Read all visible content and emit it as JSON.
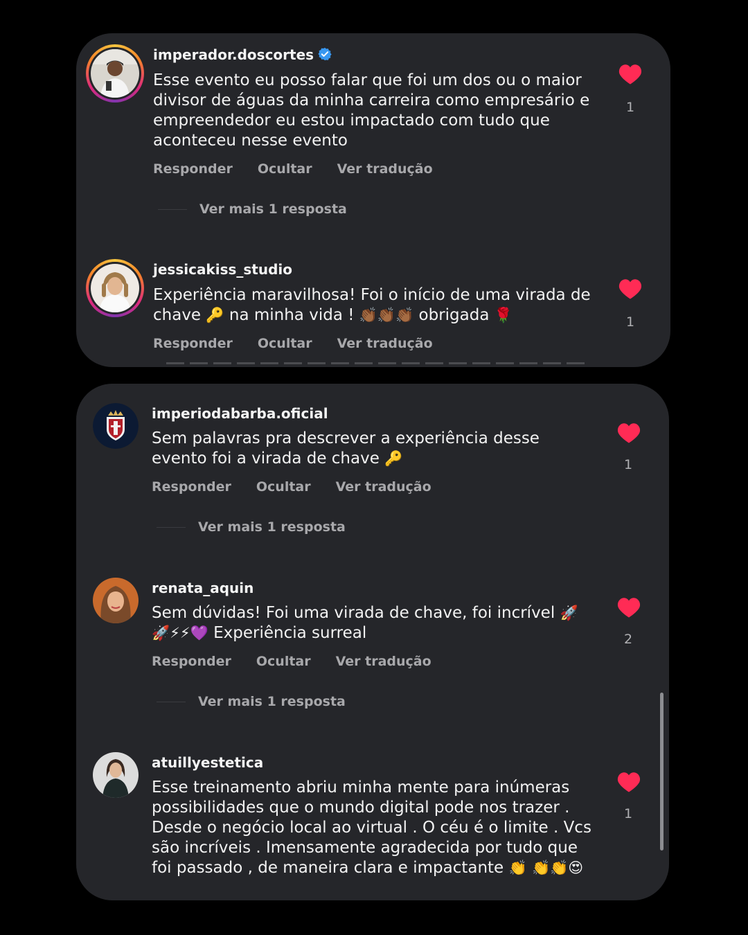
{
  "actions": {
    "reply": "Responder",
    "hide": "Ocultar",
    "translate": "Ver tradução"
  },
  "colors": {
    "card_bg": "#25262a",
    "heart": "#ff2b55",
    "muted": "#a8a8ab",
    "verified": "#3897f0"
  },
  "cards": [
    {
      "comments": [
        {
          "username": "imperador.doscortes",
          "verified": true,
          "text": "Esse evento eu posso falar que foi um dos ou o maior divisor de águas da minha carreira como empresário e empreendedor eu estou impactado com tudo que aconteceu nesse evento",
          "likes": "1",
          "more_replies": "Ver mais 1 resposta",
          "avatar_icon": "person-avatar-icon"
        },
        {
          "username": "jessicakiss_studio",
          "text_a": "Experiência maravilhosa!  Foi o início de uma virada de chave",
          "emoji_key": "🔑",
          "text_b": "na minha vida !",
          "emoji_clap": "👏🏾👏🏾👏🏾",
          "text_c": "obrigada",
          "emoji_rose": "🌹",
          "likes": "1",
          "avatar_icon": "person-avatar-icon"
        }
      ]
    },
    {
      "comments": [
        {
          "username": "imperiodabarba.oficial",
          "text_a": "Sem palavras pra descrever a experiência desse evento foi a virada de chave",
          "emoji_key": "🔑",
          "likes": "1",
          "more_replies": "Ver mais 1 resposta",
          "avatar_icon": "barbershop-logo-icon"
        },
        {
          "username": "renata_aquin",
          "text_a": "Sem dúvidas! Foi uma virada de chave, foi incrível",
          "emoji_a": "🚀",
          "emoji_b": "🚀⚡⚡💜",
          "text_b": "Experiência surreal",
          "likes": "2",
          "more_replies": "Ver mais 1 resposta",
          "avatar_icon": "person-avatar-icon"
        },
        {
          "username": "atuillyestetica",
          "text_a": "Esse treinamento abriu minha mente para inúmeras possibilidades que o mundo digital pode nos trazer . Desde o negócio local ao virtual . O céu é o limite . Vcs são incríveis . Imensamente agradecida por tudo que foi passado , de maneira clara e impactante",
          "emoji_a": "👏",
          "emoji_b": "👏👏😍",
          "likes": "1",
          "avatar_icon": "person-avatar-icon"
        }
      ]
    }
  ]
}
